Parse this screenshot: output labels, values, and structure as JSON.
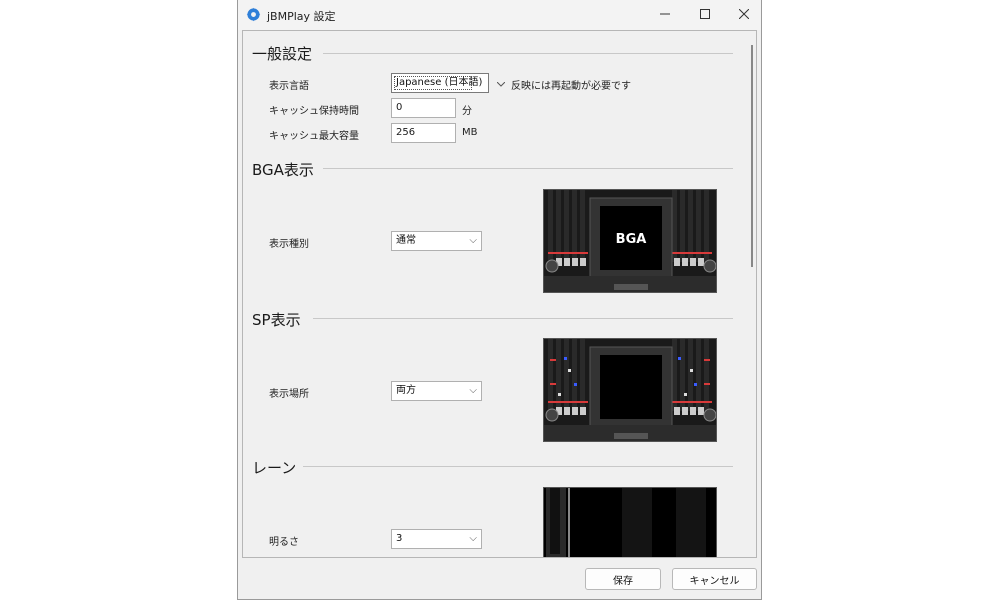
{
  "window": {
    "title": "jBMPlay 設定",
    "minimize_icon": "minimize-icon",
    "maximize_icon": "maximize-icon",
    "close_icon": "close-icon"
  },
  "general": {
    "heading": "一般設定",
    "language_label": "表示言語",
    "language_value": "Japanese (日本語)",
    "language_note": "反映には再起動が必要です",
    "cache_time_label": "キャッシュ保持時間",
    "cache_time_value": "0",
    "cache_time_unit": "分",
    "cache_size_label": "キャッシュ最大容量",
    "cache_size_value": "256",
    "cache_size_unit": "MB"
  },
  "bga": {
    "heading": "BGA表示",
    "type_label": "表示種別",
    "type_value": "通常",
    "preview_text": "BGA"
  },
  "sp": {
    "heading": "SP表示",
    "position_label": "表示場所",
    "position_value": "両方"
  },
  "lane": {
    "heading": "レーン",
    "brightness_label": "明るさ",
    "brightness_value": "3"
  },
  "footer": {
    "save_label": "保存",
    "cancel_label": "キャンセル"
  },
  "colors": {
    "accent_red": "#d83a3a",
    "note_blue": "#3a5cff"
  }
}
